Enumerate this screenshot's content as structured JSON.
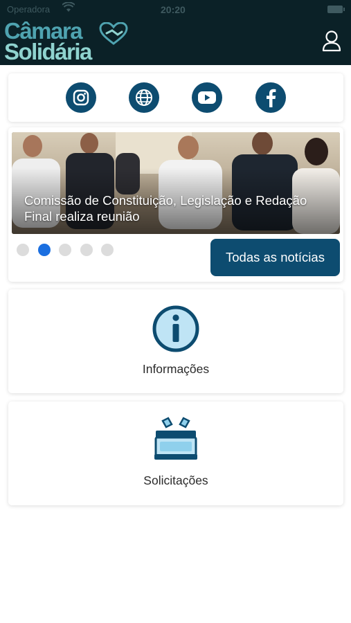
{
  "status_bar": {
    "carrier": "Operadora",
    "time": "20:20"
  },
  "app": {
    "logo_line1": "Câmara",
    "logo_line2": "Solidária"
  },
  "social_links": [
    {
      "name": "instagram-icon"
    },
    {
      "name": "globe-icon"
    },
    {
      "name": "youtube-icon"
    },
    {
      "name": "facebook-icon"
    }
  ],
  "news": {
    "title": "Comissão de Constituição, Legislação e Redação Final realiza reunião",
    "carousel_total": 5,
    "carousel_active": 2,
    "all_news_label": "Todas as notícias"
  },
  "menu": {
    "info_label": "Informações",
    "requests_label": "Solicitações"
  },
  "colors": {
    "header_bg": "#0b2127",
    "primary": "#0d4c70",
    "dot_active": "#1b6fe0",
    "dot_inactive": "#dcdcdc",
    "logo_teal": "#4fa3b0",
    "logo_mint": "#8fd3cf"
  }
}
